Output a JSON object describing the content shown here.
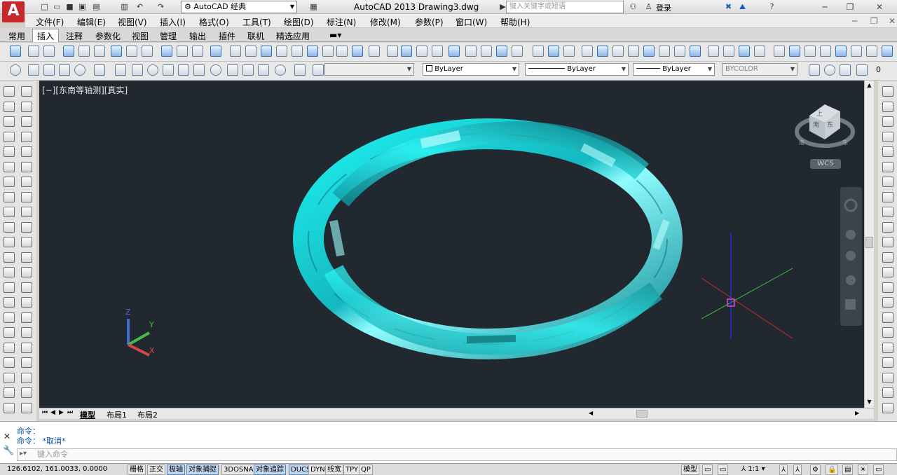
{
  "titlebar": {
    "logo": "A",
    "workspace": "AutoCAD 经典",
    "app_title": "AutoCAD 2013    Drawing3.dwg",
    "search_placeholder": "键入关键字或短语",
    "login": "登录"
  },
  "menu": [
    "文件(F)",
    "编辑(E)",
    "视图(V)",
    "插入(I)",
    "格式(O)",
    "工具(T)",
    "绘图(D)",
    "标注(N)",
    "修改(M)",
    "参数(P)",
    "窗口(W)",
    "帮助(H)"
  ],
  "ribbon_tabs": {
    "items": [
      "常用",
      "插入",
      "注释",
      "参数化",
      "视图",
      "管理",
      "输出",
      "插件",
      "联机",
      "精选应用"
    ],
    "active": "插入"
  },
  "properties": {
    "color": "ByLayer",
    "linetype": "ByLayer",
    "lineweight": "ByLayer",
    "plotstyle": "BYCOLOR",
    "layer_value": "0"
  },
  "viewport": {
    "label": "[−][东南等轴测][真实]",
    "viewcube_top": "上",
    "viewcube_front": "南",
    "viewcube_right": "东",
    "viewcube_south_label": "南",
    "viewcube_east_label": "东",
    "wcs": "WCS",
    "ucs_x": "X",
    "ucs_y": "Y",
    "ucs_z": "Z",
    "model_color": "#22e0e0",
    "background": "#212830"
  },
  "layout_tabs": [
    "模型",
    "布局1",
    "布局2"
  ],
  "command": {
    "line1": "命令：",
    "line2": "命令： *取消*",
    "input_placeholder": "键入命令"
  },
  "status": {
    "coords": "126.6102, 161.0033, 0.0000",
    "toggles": [
      {
        "label": "栅格",
        "on": false
      },
      {
        "label": "正交",
        "on": false
      },
      {
        "label": "极轴",
        "on": true
      },
      {
        "label": "对象捕捉",
        "on": true
      },
      {
        "label": "3DOSNAP",
        "on": false
      },
      {
        "label": "对象追踪",
        "on": true
      },
      {
        "label": "DUCS",
        "on": true
      },
      {
        "label": "DYN",
        "on": false
      },
      {
        "label": "线宽",
        "on": false
      },
      {
        "label": "TPY",
        "on": false
      },
      {
        "label": "QP",
        "on": false
      }
    ],
    "model": "模型",
    "scale": "1:1"
  }
}
